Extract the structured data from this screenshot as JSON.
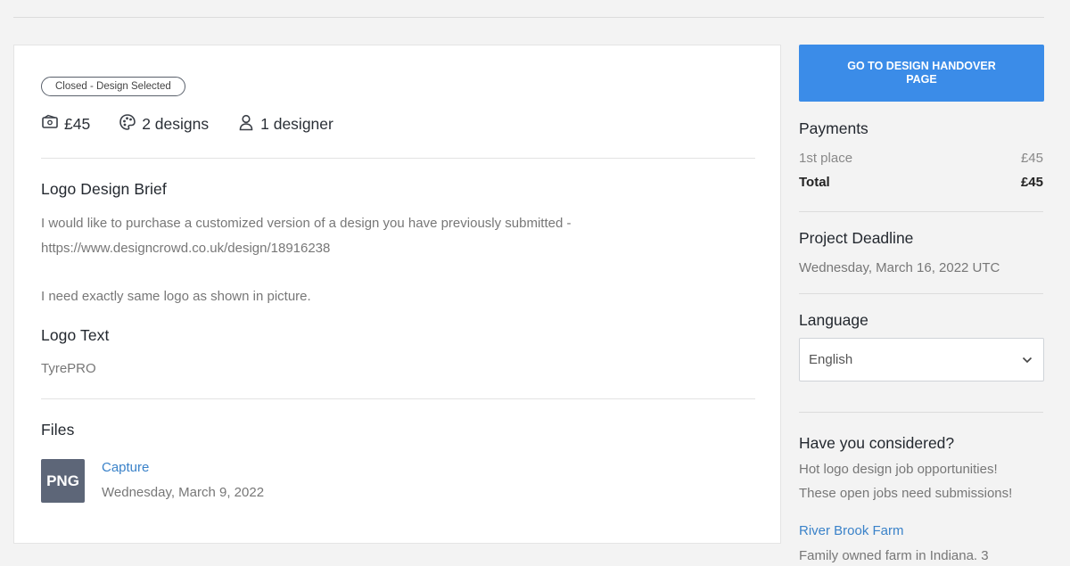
{
  "contest": {
    "status": "Closed - Design Selected",
    "stats": {
      "prize": "£45",
      "designs": "2 designs",
      "designers": "1 designer"
    },
    "brief": {
      "heading": "Logo Design Brief",
      "line1": "I would like to purchase a customized version of a design you have previously submitted -",
      "line2": "https://www.designcrowd.co.uk/design/18916238",
      "line3": "I need exactly same logo as shown in picture."
    },
    "logo_text": {
      "heading": "Logo Text",
      "value": "TyrePRO"
    },
    "files": {
      "heading": "Files",
      "items": [
        {
          "type": "PNG",
          "name": "Capture",
          "date": "Wednesday, March 9, 2022"
        }
      ]
    }
  },
  "sidebar": {
    "handover_button": "GO TO DESIGN HANDOVER PAGE",
    "payments": {
      "heading": "Payments",
      "rows": [
        {
          "label": "1st place",
          "amount": "£45"
        },
        {
          "label": "Total",
          "amount": "£45"
        }
      ]
    },
    "deadline": {
      "heading": "Project Deadline",
      "value": "Wednesday, March 16, 2022 UTC"
    },
    "language": {
      "heading": "Language",
      "selected": "English"
    },
    "considered": {
      "heading": "Have you considered?",
      "line1": "Hot logo design job opportunities!",
      "line2": "These open jobs need submissions!",
      "job_title": "River Brook Farm",
      "job_desc": "Family owned farm in Indiana. 3"
    }
  },
  "colors": {
    "accent": "#3b8ce8",
    "link": "#3a82c9",
    "file_thumb": "#5d6678"
  }
}
